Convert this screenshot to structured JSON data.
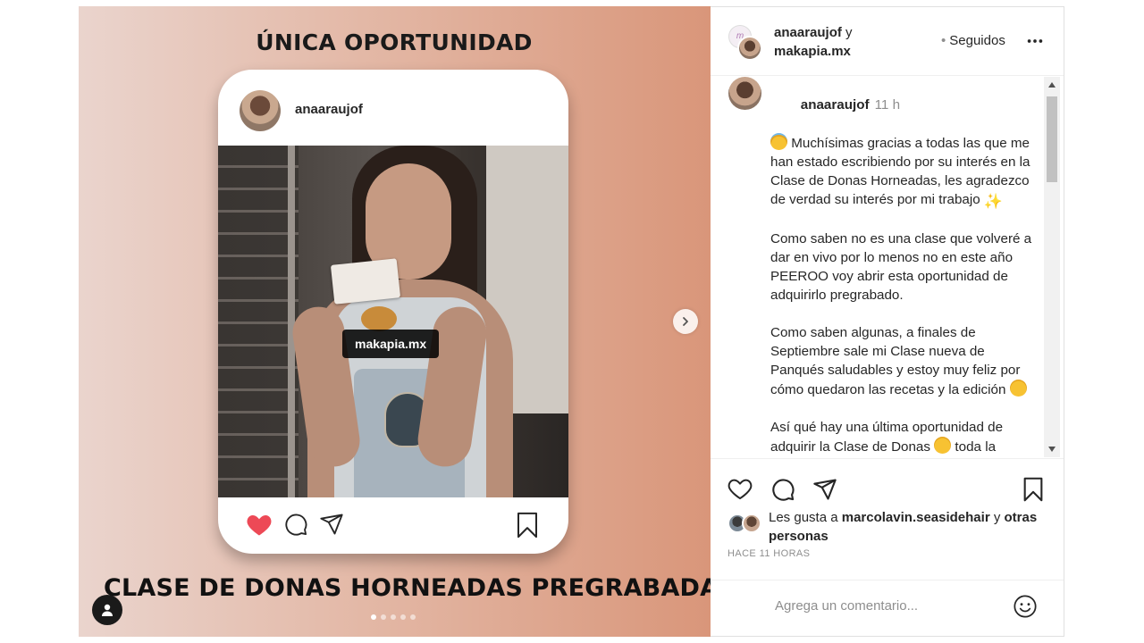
{
  "media": {
    "headline_top": "ÚNICA OPORTUNIDAD",
    "headline_bottom": "CLASE DE DONAS HORNEADAS PREGRABADA",
    "phone_username": "anaaraujof",
    "tag_label": "makapia.mx",
    "carousel_total": 5,
    "carousel_active": 1,
    "next_icon": "chevron-right-icon",
    "user_tag_icon": "user-icon",
    "heart_color": "#ed4956"
  },
  "header": {
    "user1": "anaaraujof",
    "joiner": "y",
    "user2": "makapia.mx",
    "separator": "•",
    "follow_label": "Seguidos",
    "more_icon": "more-horizontal-icon"
  },
  "caption": {
    "username": "anaaraujof",
    "time": "11 h",
    "paragraphs": [
      " Muchísimas gracias a todas las que me han estado escribiendo por su interés en la Clase de Donas Horneadas, les agradezco de verdad su interés por mi trabajo ",
      "Como saben no es una clase que volveré a dar en vivo por lo menos no en este año PEEROO voy abrir esta oportunidad de adquirirlo pregrabado.",
      "Como saben algunas, a finales de Septiembre sale mi Clase nueva de Panqués saludables y estoy muy feliz por cómo quedaron las recetas y la edición ",
      "Así qué hay una última oportunidad de adquirir la Clase de Donas ",
      " toda la"
    ]
  },
  "actions": {
    "like_icon": "heart-icon",
    "comment_icon": "comment-icon",
    "share_icon": "send-icon",
    "save_icon": "bookmark-icon"
  },
  "likes": {
    "prefix": "Les gusta a",
    "user": "marcolavin.seasidehair",
    "joiner": "y",
    "others": "otras personas"
  },
  "timestamp": "HACE 11 HORAS",
  "comment": {
    "placeholder": "Agrega un comentario...",
    "emoji_icon": "smiley-icon"
  }
}
